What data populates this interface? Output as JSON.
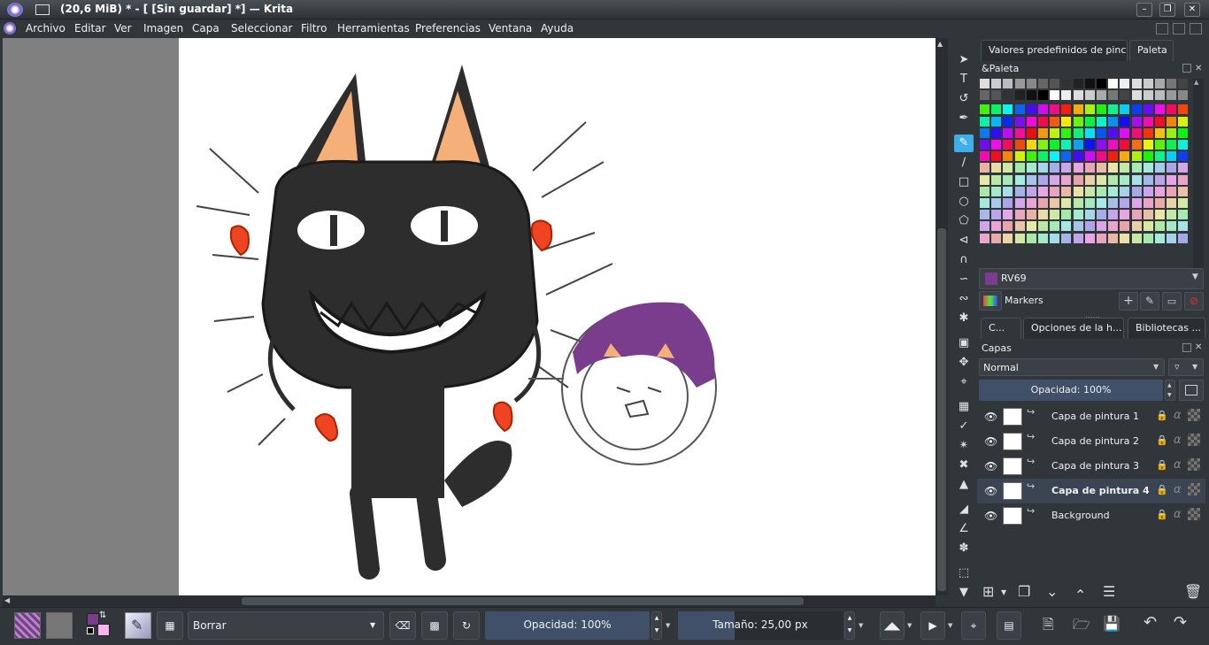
{
  "window": {
    "title": "(20,6 MiB)  * - [ [Sin guardar]  *] — Krita"
  },
  "menu": [
    "Archivo",
    "Editar",
    "Ver",
    "Imagen",
    "Capa",
    "Seleccionar",
    "Filtro",
    "Herramientas",
    "Preferencias",
    "Ventana",
    "Ayuda"
  ],
  "dock_tabs_top": [
    "Valores predefinidos de pincel",
    "Paleta"
  ],
  "palette": {
    "title": "&Paleta",
    "selected_color_name": "RV69",
    "selected_color": "#7a3c8c",
    "set_name": "Markers"
  },
  "dock_tabs_layers": [
    "C...",
    "Opciones de la h...",
    "Bibliotecas ..."
  ],
  "layers": {
    "title": "Capas",
    "blend_mode": "Normal",
    "opacity": "Opacidad:  100%",
    "items": [
      {
        "name": "Capa de pintura 1",
        "active": false,
        "locked": false
      },
      {
        "name": "Capa de pintura 2",
        "active": false,
        "locked": false
      },
      {
        "name": "Capa de pintura 3",
        "active": false,
        "locked": false
      },
      {
        "name": "Capa de pintura 4",
        "active": true,
        "locked": false
      },
      {
        "name": "Background",
        "active": false,
        "locked": true
      }
    ]
  },
  "brush": {
    "blend_mode": "Borrar",
    "opacity": "Opacidad: 100%",
    "size": "Tamaño: 25,00 px"
  },
  "colors": {
    "accent": "#3daee9",
    "fg": "#7a3c8c",
    "bg": "#ffffff"
  }
}
